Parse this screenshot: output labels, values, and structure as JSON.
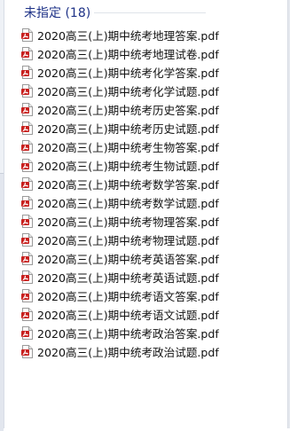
{
  "group": {
    "title": "未指定 (18)"
  },
  "files": [
    {
      "name": "2020高三(上)期中统考地理答案.pdf"
    },
    {
      "name": "2020高三(上)期中统考地理试卷.pdf"
    },
    {
      "name": "2020高三(上)期中统考化学答案.pdf"
    },
    {
      "name": "2020高三(上)期中统考化学试题.pdf"
    },
    {
      "name": "2020高三(上)期中统考历史答案.pdf"
    },
    {
      "name": "2020高三(上)期中统考历史试题.pdf"
    },
    {
      "name": "2020高三(上)期中统考生物答案.pdf"
    },
    {
      "name": "2020高三(上)期中统考生物试题.pdf"
    },
    {
      "name": "2020高三(上)期中统考数学答案.pdf"
    },
    {
      "name": "2020高三(上)期中统考数学试题.pdf"
    },
    {
      "name": "2020高三(上)期中统考物理答案.pdf"
    },
    {
      "name": "2020高三(上)期中统考物理试题.pdf"
    },
    {
      "name": "2020高三(上)期中统考英语答案.pdf"
    },
    {
      "name": "2020高三(上)期中统考英语试题.pdf"
    },
    {
      "name": "2020高三(上)期中统考语文答案.pdf"
    },
    {
      "name": "2020高三(上)期中统考语文试题.pdf"
    },
    {
      "name": "2020高三(上)期中统考政治答案.pdf"
    },
    {
      "name": "2020高三(上)期中统考政治试题.pdf"
    }
  ],
  "icons": {
    "file": "pdf-file-icon"
  },
  "colors": {
    "group_title": "#1e3287",
    "pdf_red": "#c8201e"
  }
}
